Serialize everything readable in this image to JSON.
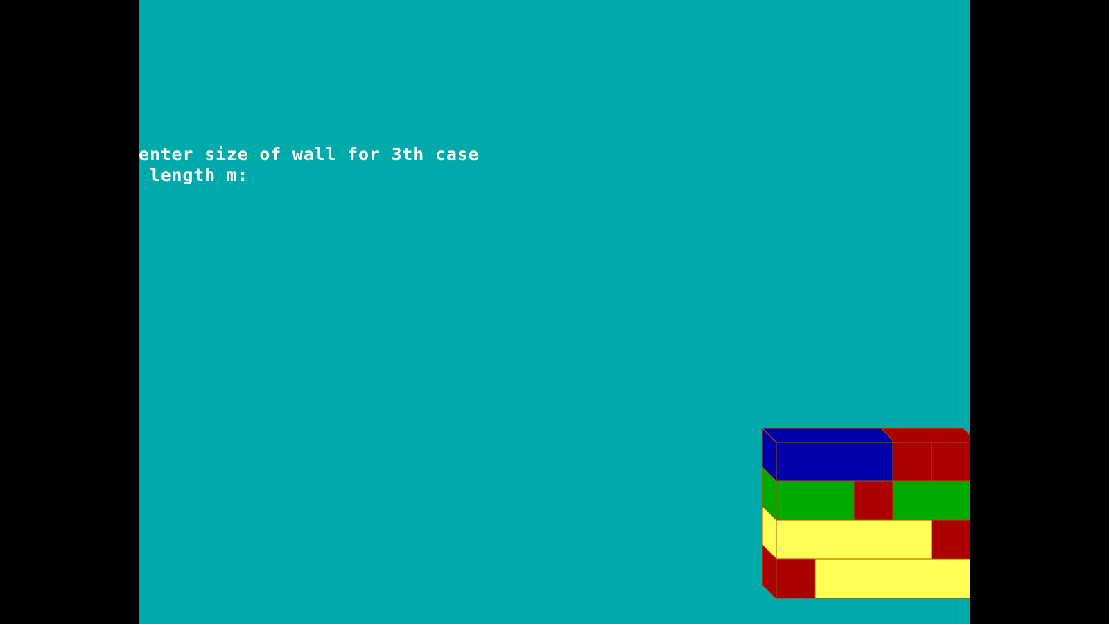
{
  "console": {
    "line1": "enter size of wall for 3th case",
    "line2": " length m:"
  },
  "wall_graphic": {
    "rows": [
      [
        "blue",
        "red",
        "red"
      ],
      [
        "green",
        "red",
        "green"
      ],
      [
        "yellow",
        "red"
      ],
      [
        "red",
        "yellow"
      ]
    ]
  },
  "colors": {
    "background": "#00AAAA",
    "letterbox": "#000000",
    "text": "#FFFFFF",
    "blue": "#0000AA",
    "red": "#AA0000",
    "green": "#00AA00",
    "yellow": "#FFFF55",
    "mortar": "#AA5500"
  }
}
